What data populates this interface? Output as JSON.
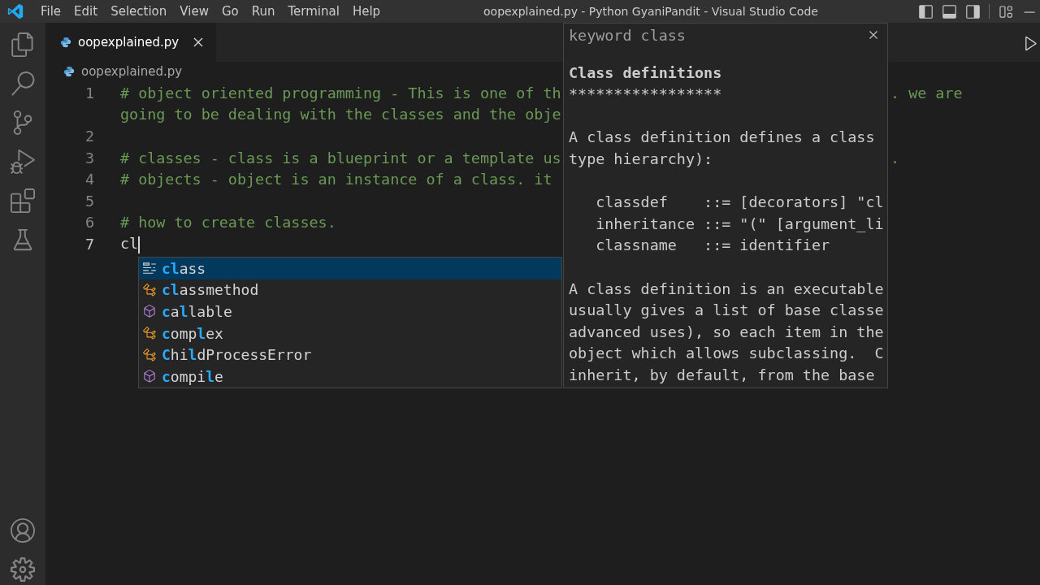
{
  "menu": [
    "File",
    "Edit",
    "Selection",
    "View",
    "Go",
    "Run",
    "Terminal",
    "Help"
  ],
  "window": {
    "title": "oopexplained.py - Python GyaniPandit - Visual Studio Code"
  },
  "tabs": [
    {
      "label": "oopexplained.py",
      "selected": true
    }
  ],
  "breadcrumb": "oopexplained.py",
  "lines": [
    {
      "number": "1",
      "kind": "comment",
      "text": "# object oriented programming - This is one of th",
      "tail": ". we are"
    },
    {
      "kind": "comment",
      "text": "going to be dealing with the classes and the obje"
    },
    {
      "number": "2"
    },
    {
      "number": "3",
      "kind": "comment",
      "text": "# classes - class is a blueprint or a template us",
      "tail": "."
    },
    {
      "number": "4",
      "kind": "comment",
      "text": "# objects - object is an instance of a class. it"
    },
    {
      "number": "5"
    },
    {
      "number": "6",
      "kind": "comment",
      "text": "# how to create classes."
    },
    {
      "number": "7",
      "kind": "code",
      "text": "cl",
      "cursor": true
    }
  ],
  "suggestions": [
    {
      "kind": "keyword",
      "label": "**cl**ass",
      "selected": true
    },
    {
      "kind": "class",
      "label": "**cl**assmethod",
      "selected": false
    },
    {
      "kind": "function",
      "label": "**c**a**l**lable",
      "selected": false
    },
    {
      "kind": "class",
      "label": "**c**omp**l**ex",
      "selected": false
    },
    {
      "kind": "class",
      "label": "**C**hi**l**dProcessError",
      "selected": false
    },
    {
      "kind": "function",
      "label": "**c**ompi**l**e",
      "selected": false
    }
  ],
  "hover": {
    "title": "keyword class",
    "lines": [
      {
        "kind": "heading",
        "text": "Class definitions"
      },
      {
        "kind": "text",
        "text": "*****************"
      },
      {
        "kind": "blank"
      },
      {
        "kind": "text",
        "text": "A class definition defines a class"
      },
      {
        "kind": "text",
        "text": "type hierarchy):"
      },
      {
        "kind": "blank"
      },
      {
        "kind": "text",
        "text": "   classdef    ::= [decorators] \"cl"
      },
      {
        "kind": "text",
        "text": "   inheritance ::= \"(\" [argument_li"
      },
      {
        "kind": "text",
        "text": "   classname   ::= identifier"
      },
      {
        "kind": "blank"
      },
      {
        "kind": "text",
        "text": "A class definition is an executable"
      },
      {
        "kind": "text",
        "text": "usually gives a list of base classe"
      },
      {
        "kind": "text",
        "text": "advanced uses), so each item in the"
      },
      {
        "kind": "text",
        "text": "object which allows subclassing.  C"
      },
      {
        "kind": "text",
        "text": "inherit, by default, from the base"
      }
    ]
  }
}
